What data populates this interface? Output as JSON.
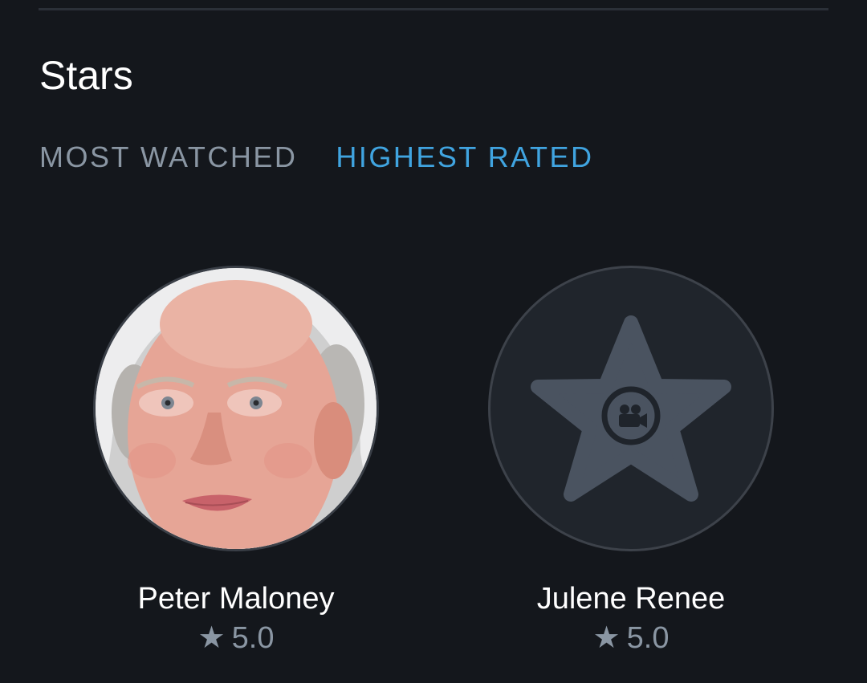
{
  "section": {
    "title": "Stars"
  },
  "tabs": [
    {
      "label": "MOST WATCHED",
      "active": false
    },
    {
      "label": "HIGHEST RATED",
      "active": true
    }
  ],
  "stars": [
    {
      "name": "Peter Maloney",
      "rating": "5.0",
      "avatar": "photo"
    },
    {
      "name": "Julene Renee",
      "rating": "5.0",
      "avatar": "star-placeholder-icon"
    }
  ],
  "icons": {
    "rating_star": "★"
  },
  "colors": {
    "background": "#14171c",
    "accent": "#40a4e0",
    "muted": "#8a96a3"
  }
}
